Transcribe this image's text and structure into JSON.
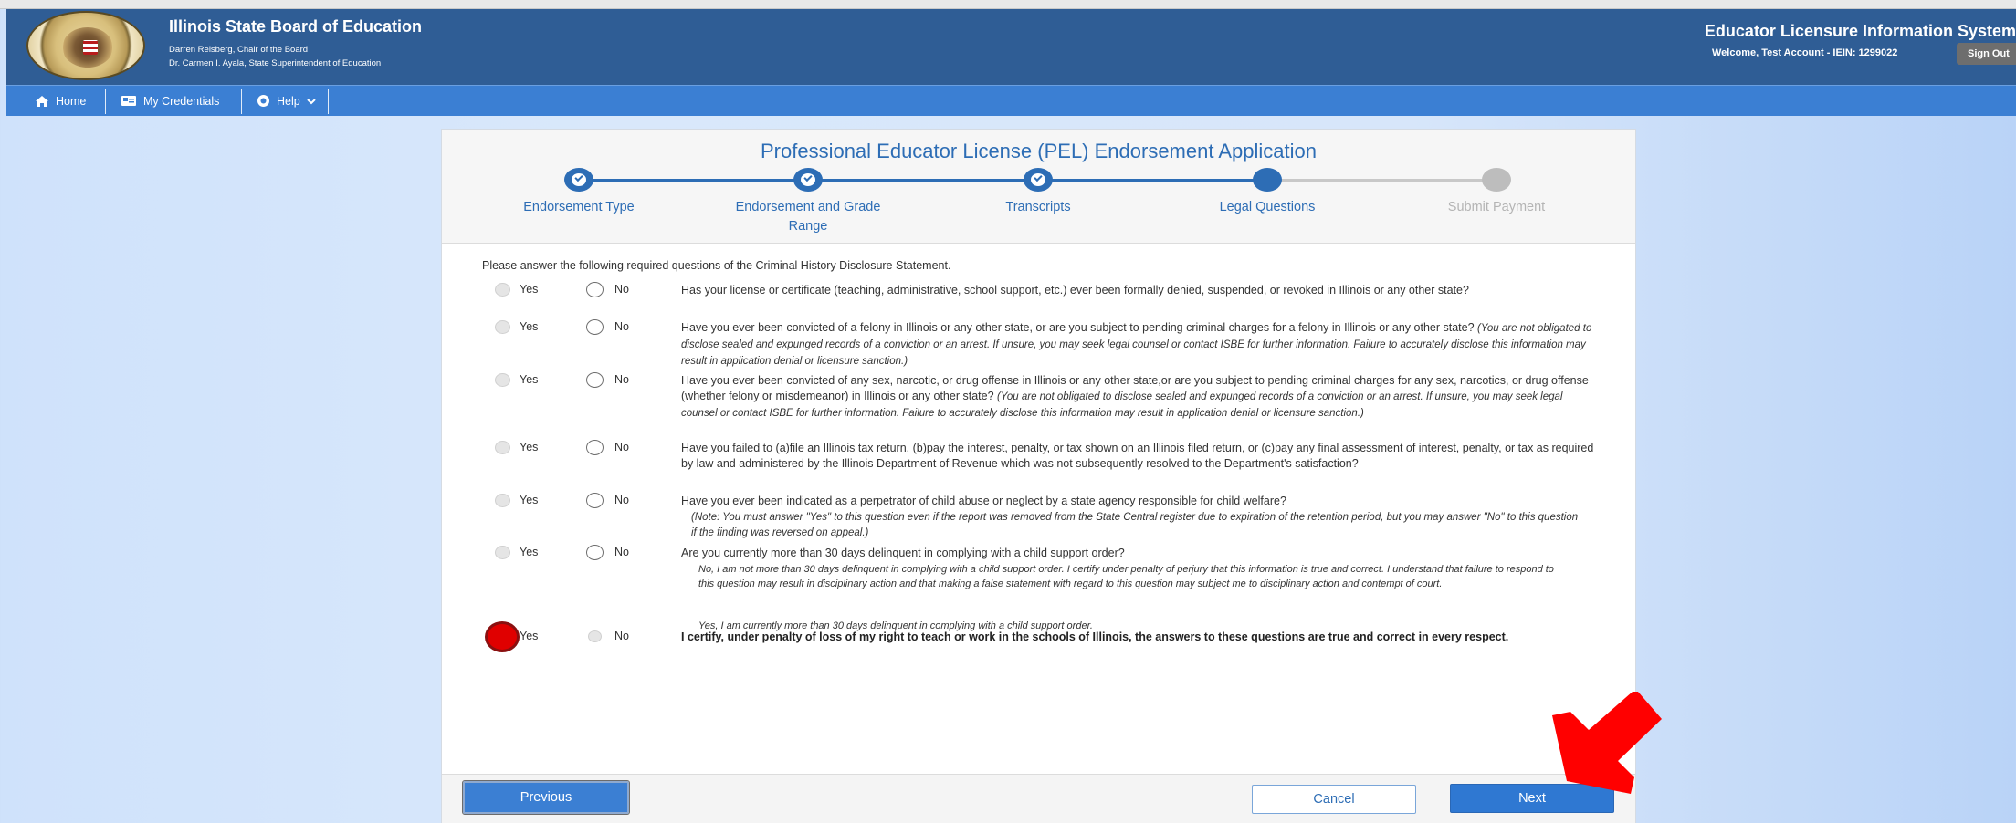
{
  "header": {
    "org_title": "Illinois State Board of Education",
    "chair": "Darren Reisberg, Chair of the Board",
    "superintendent": "Dr. Carmen I. Ayala, State Superintendent of Education",
    "system_title": "Educator Licensure Information System",
    "welcome": "Welcome, Test Account - IEIN: 1299022",
    "sign_out": "Sign Out"
  },
  "nav": {
    "home": "Home",
    "credentials": "My Credentials",
    "help": "Help"
  },
  "card": {
    "title": "Professional Educator License (PEL) Endorsement Application",
    "steps": [
      {
        "label": "Endorsement Type",
        "state": "done"
      },
      {
        "label": "Endorsement and Grade Range",
        "state": "done"
      },
      {
        "label": "Transcripts",
        "state": "done"
      },
      {
        "label": "Legal Questions",
        "state": "active"
      },
      {
        "label": "Submit Payment",
        "state": "pending"
      }
    ],
    "intro": "Please answer the following required questions of the Criminal History Disclosure Statement.",
    "yes": "Yes",
    "no": "No",
    "questions": [
      {
        "text": "Has your license or certificate (teaching, administrative, school support, etc.) ever been formally denied, suspended, or revoked in Illinois or any other state?"
      },
      {
        "text": "Have you ever been convicted of a felony in Illinois or any other state, or are you subject to pending criminal charges for a felony in Illinois or any other state?",
        "note": "(You are not obligated to disclose sealed and expunged records of a conviction or an arrest. If unsure, you may seek legal counsel or contact ISBE for further information. Failure to accurately disclose this information may result in application denial or licensure sanction.)"
      },
      {
        "text": "Have you ever been convicted of any sex, narcotic, or drug offense in Illinois or any other state,or are you subject to pending criminal charges for any sex, narcotics, or drug offense (whether felony or misdemeanor) in Illinois or any other state?",
        "note": "(You are not obligated to disclose sealed and expunged records of a conviction or an arrest. If unsure, you may seek legal counsel or contact ISBE for further information. Failure to accurately disclose this information may result in application denial or licensure sanction.)"
      },
      {
        "text": "Have you failed to (a)file an Illinois tax return, (b)pay the interest, penalty, or tax shown on an Illinois filed return, or (c)pay any final assessment of interest, penalty, or tax as required by law and administered by the Illinois Department of Revenue which was not subsequently resolved to the Department's satisfaction?"
      },
      {
        "text": "Have you ever been indicated as a perpetrator of child abuse or neglect by a state agency responsible for child welfare?",
        "note": "(Note: You must answer \"Yes\" to this question even if the report was removed from the State Central register due to expiration of the retention period, but you may answer \"No\" to this question if the finding was reversed on appeal.)"
      },
      {
        "text": "Are you currently more than 30 days delinquent in complying with a child support order?",
        "note_no": "No, I am not more than 30 days delinquent in complying with a child support order. I certify under penalty of perjury that this information is true and correct. I understand that failure to respond to this question may result in disciplinary action and that making a false statement with regard to this question may subject me to disciplinary action and contempt of court.",
        "note_yes": "Yes, I am currently more than 30 days delinquent in complying with a child support order."
      },
      {
        "text": "I certify, under penalty of loss of my right to teach or work in the schools of Illinois, the answers to these questions are true and correct in every respect."
      }
    ],
    "previous": "Previous",
    "cancel": "Cancel",
    "next": "Next"
  },
  "colors": {
    "header_bg": "#2f5d95",
    "nav_bg": "#3b7fd3",
    "accent": "#2d6db5",
    "annotation_red": "#ff0000"
  }
}
